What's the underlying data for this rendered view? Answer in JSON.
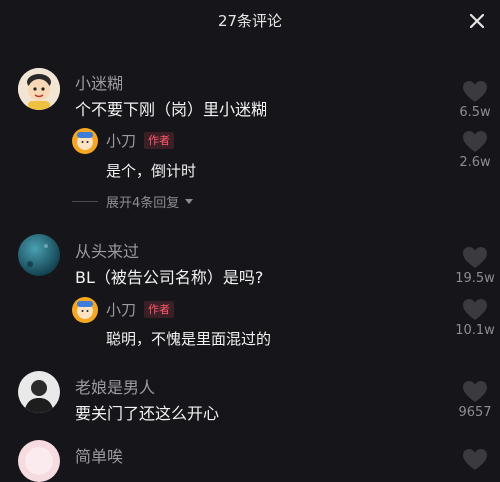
{
  "header": {
    "title": "27条评论",
    "close_icon": "close-icon"
  },
  "colors": {
    "background": "#16161a",
    "author_badge": "#ff5a6a",
    "meta": "#9a9a9f"
  },
  "comments": [
    {
      "username": "小迷糊",
      "text": "个不要下刚（岗）里小迷糊",
      "likes": "6.5w",
      "replies": [
        {
          "username": "小刀",
          "badge": "作者",
          "text": "是个，倒计时",
          "likes": "2.6w"
        }
      ],
      "expand_label": "展开4条回复"
    },
    {
      "username": "从头来过",
      "text": "BL（被告公司名称）是吗?",
      "likes": "19.5w",
      "replies": [
        {
          "username": "小刀",
          "badge": "作者",
          "text": "聪明，不愧是里面混过的",
          "likes": "10.1w"
        }
      ]
    },
    {
      "username": "老娘是男人",
      "text": "要关门了还这么开心",
      "likes": "9657"
    },
    {
      "username": "简单唉",
      "text": ""
    }
  ]
}
